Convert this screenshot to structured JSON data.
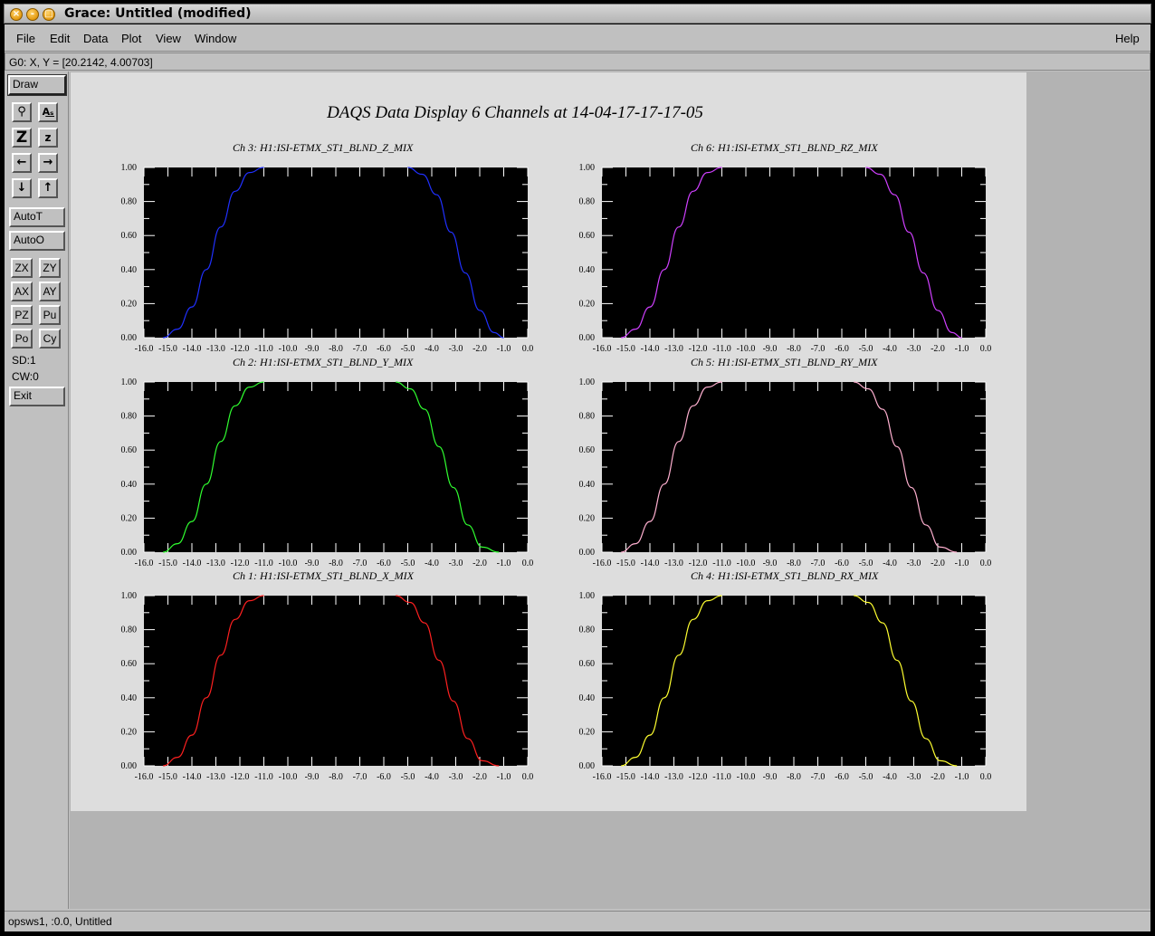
{
  "window": {
    "title": "Grace: Untitled (modified)"
  },
  "menubar": {
    "file": "File",
    "edit": "Edit",
    "data": "Data",
    "plot": "Plot",
    "view": "View",
    "window": "Window",
    "help": "Help"
  },
  "coords": "G0: X, Y = [20.2142, 4.00703]",
  "tools": {
    "draw": "Draw",
    "icon_buttons": [
      "magnifier-icon",
      "text-icon",
      "zoom-big-icon",
      "zoom-small-icon",
      "arrow-left-icon",
      "arrow-right-icon",
      "arrow-down-icon",
      "arrow-up-icon"
    ],
    "autot": "AutoT",
    "autoo": "AutoO",
    "small": [
      "ZX",
      "ZY",
      "AX",
      "AY",
      "PZ",
      "Pu",
      "Po",
      "Cy"
    ],
    "sd": "SD:1",
    "cw": "CW:0",
    "exit": "Exit"
  },
  "status": "opsws1, :0.0, Untitled",
  "colors": {
    "plot_bg": "#000000",
    "page_bg": "#dddddd"
  },
  "chart_data": {
    "title": "DAQS Data Display 6 Channels at 14-04-17-17-17-05",
    "xlim": [
      -16.0,
      0.0
    ],
    "ylim": [
      0.0,
      1.0
    ],
    "xticks": [
      "-16.0",
      "-15.0",
      "-14.0",
      "-13.0",
      "-12.0",
      "-11.0",
      "-10.0",
      "-9.0",
      "-8.0",
      "-7.0",
      "-6.0",
      "-5.0",
      "-4.0",
      "-3.0",
      "-2.0",
      "-1.0",
      "0.0"
    ],
    "yticks": [
      "0.00",
      "0.20",
      "0.40",
      "0.60",
      "0.80",
      "1.00"
    ],
    "panels": [
      {
        "title": "Ch 3:  H1:ISI-ETMX_ST1_BLND_Z_MIX",
        "color": "#2030ff",
        "type": "line",
        "x": [
          -15.2,
          -14.6,
          -14.0,
          -13.4,
          -12.8,
          -12.2,
          -11.6,
          -11.0,
          -5.0,
          -4.4,
          -3.8,
          -3.2,
          -2.6,
          -2.0,
          -1.4,
          -1.0
        ],
        "y": [
          0.0,
          0.05,
          0.18,
          0.4,
          0.65,
          0.86,
          0.97,
          1.0,
          1.0,
          0.96,
          0.84,
          0.62,
          0.38,
          0.16,
          0.03,
          0.0
        ]
      },
      {
        "title": "Ch 6:  H1:ISI-ETMX_ST1_BLND_RZ_MIX",
        "color": "#d040ff",
        "type": "line",
        "x": [
          -15.2,
          -14.6,
          -14.0,
          -13.4,
          -12.8,
          -12.2,
          -11.6,
          -11.0,
          -5.0,
          -4.4,
          -3.8,
          -3.2,
          -2.6,
          -2.0,
          -1.4,
          -1.0
        ],
        "y": [
          0.0,
          0.05,
          0.18,
          0.4,
          0.65,
          0.86,
          0.97,
          1.0,
          1.0,
          0.96,
          0.84,
          0.62,
          0.38,
          0.16,
          0.03,
          0.0
        ]
      },
      {
        "title": "Ch 2:  H1:ISI-ETMX_ST1_BLND_Y_MIX",
        "color": "#30ff30",
        "type": "line",
        "x": [
          -15.2,
          -14.6,
          -14.0,
          -13.4,
          -12.8,
          -12.2,
          -11.6,
          -11.0,
          -5.5,
          -4.9,
          -4.3,
          -3.7,
          -3.1,
          -2.5,
          -1.9,
          -1.2
        ],
        "y": [
          0.0,
          0.05,
          0.18,
          0.4,
          0.65,
          0.86,
          0.97,
          1.0,
          1.0,
          0.96,
          0.84,
          0.62,
          0.38,
          0.16,
          0.03,
          0.0
        ]
      },
      {
        "title": "Ch 5:  H1:ISI-ETMX_ST1_BLND_RY_MIX",
        "color": "#ffb0d0",
        "type": "line",
        "x": [
          -15.2,
          -14.6,
          -14.0,
          -13.4,
          -12.8,
          -12.2,
          -11.6,
          -11.0,
          -5.5,
          -4.9,
          -4.3,
          -3.7,
          -3.1,
          -2.5,
          -1.9,
          -1.2
        ],
        "y": [
          0.0,
          0.05,
          0.18,
          0.4,
          0.65,
          0.86,
          0.97,
          1.0,
          1.0,
          0.96,
          0.84,
          0.62,
          0.38,
          0.16,
          0.03,
          0.0
        ]
      },
      {
        "title": "Ch 1:  H1:ISI-ETMX_ST1_BLND_X_MIX",
        "color": "#ff2020",
        "type": "line",
        "x": [
          -15.2,
          -14.6,
          -14.0,
          -13.4,
          -12.8,
          -12.2,
          -11.6,
          -11.0,
          -5.5,
          -4.9,
          -4.3,
          -3.7,
          -3.1,
          -2.5,
          -1.9,
          -1.2
        ],
        "y": [
          0.0,
          0.05,
          0.18,
          0.4,
          0.65,
          0.86,
          0.97,
          1.0,
          1.0,
          0.96,
          0.84,
          0.62,
          0.38,
          0.16,
          0.03,
          0.0
        ]
      },
      {
        "title": "Ch 4:  H1:ISI-ETMX_ST1_BLND_RX_MIX",
        "color": "#ffff30",
        "type": "line",
        "x": [
          -15.2,
          -14.6,
          -14.0,
          -13.4,
          -12.8,
          -12.2,
          -11.6,
          -11.0,
          -5.5,
          -4.9,
          -4.3,
          -3.7,
          -3.1,
          -2.5,
          -1.9,
          -1.2
        ],
        "y": [
          0.0,
          0.05,
          0.18,
          0.4,
          0.65,
          0.86,
          0.97,
          1.0,
          1.0,
          0.96,
          0.84,
          0.62,
          0.38,
          0.16,
          0.03,
          0.0
        ]
      }
    ]
  }
}
